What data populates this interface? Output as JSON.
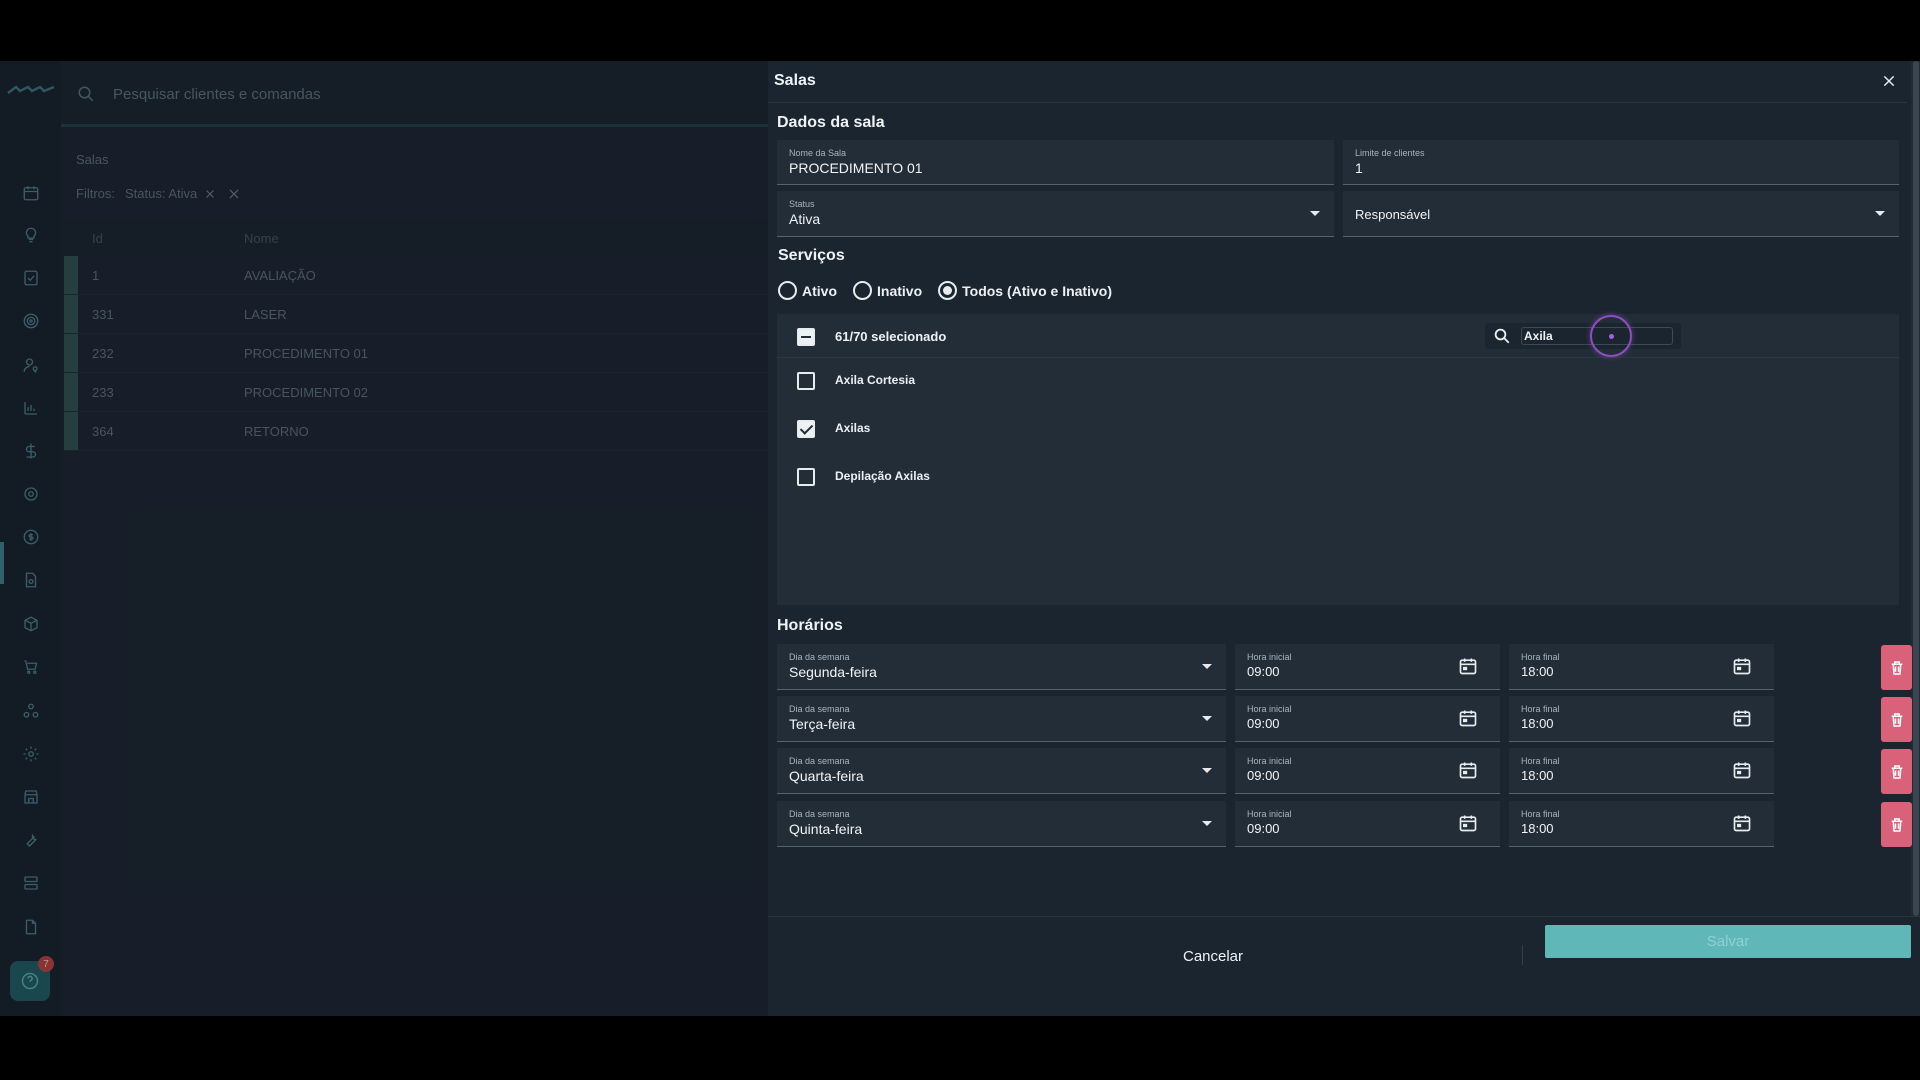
{
  "topbar": {
    "search_placeholder": "Pesquisar clientes e comandas"
  },
  "sidebar": {
    "icons": [
      "calendar-icon",
      "lightbulb-icon",
      "checklist-icon",
      "target-icon",
      "user-search-icon",
      "chart-icon",
      "dollar-icon",
      "settings-cog-icon",
      "money-circle-icon",
      "document-gear-icon",
      "package-icon",
      "cart-icon",
      "network-icon",
      "gear-icon",
      "store-icon",
      "wrench-icon",
      "server-icon",
      "file-icon",
      "play-icon"
    ],
    "help_badge": "7"
  },
  "page": {
    "title": "Salas",
    "filters_label": "Filtros:",
    "filter_chip": "Status: Ativa",
    "columns": [
      "Id",
      "Nome"
    ],
    "rows": [
      {
        "id": "1",
        "name": "AVALIAÇÃO"
      },
      {
        "id": "331",
        "name": "LASER"
      },
      {
        "id": "232",
        "name": "PROCEDIMENTO 01"
      },
      {
        "id": "233",
        "name": "PROCEDIMENTO 02"
      },
      {
        "id": "364",
        "name": "RETORNO"
      }
    ]
  },
  "dialog": {
    "title": "Salas",
    "room_section": "Dados da sala",
    "room_name_label": "Nome da Sala",
    "room_name_value": "PROCEDIMENTO 01",
    "client_limit_label": "Limite de clientes",
    "client_limit_value": "1",
    "status_label": "Status",
    "status_value": "Ativa",
    "responsible_label": "Responsável",
    "services_section": "Serviços",
    "radio_options": [
      "Ativo",
      "Inativo",
      "Todos (Ativo e Inativo)"
    ],
    "radio_selected": "Todos (Ativo e Inativo)",
    "selected_count": "61/70 selecionado",
    "service_search_value": "Axila",
    "services": [
      {
        "name": "Axila Cortesia",
        "checked": false
      },
      {
        "name": "Axilas",
        "checked": true
      },
      {
        "name": "Depilação Axilas",
        "checked": false
      }
    ],
    "schedule_section": "Horários",
    "day_label": "Dia da semana",
    "start_label": "Hora inicial",
    "end_label": "Hora final",
    "schedules": [
      {
        "day": "Segunda-feira",
        "start": "09:00",
        "end": "18:00"
      },
      {
        "day": "Terça-feira",
        "start": "09:00",
        "end": "18:00"
      },
      {
        "day": "Quarta-feira",
        "start": "09:00",
        "end": "18:00"
      },
      {
        "day": "Quinta-feira",
        "start": "09:00",
        "end": "18:00"
      }
    ],
    "cancel_label": "Cancelar",
    "save_label": "Salvar"
  },
  "colors": {
    "accent": "#5fb7b7",
    "danger": "#d9627a",
    "panel": "#1b252f"
  }
}
